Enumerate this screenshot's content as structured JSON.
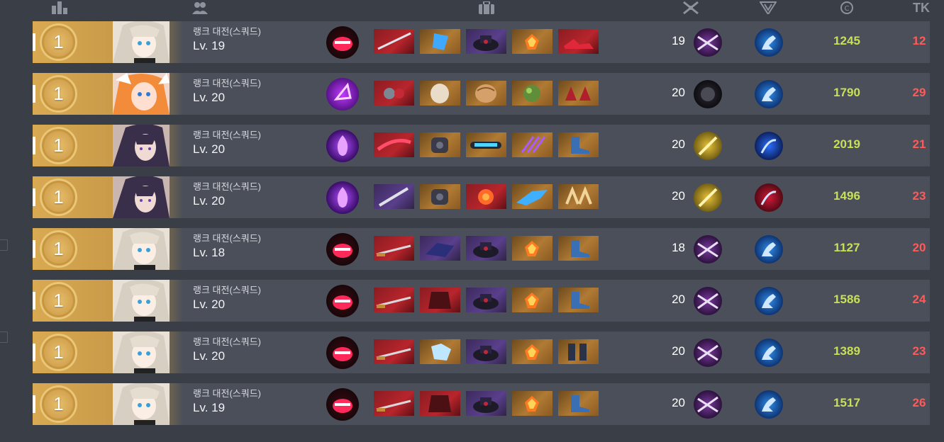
{
  "header": {
    "kills_label": "TK",
    "icons": [
      "rank-bar-icon",
      "party-icon",
      "equipment-bag-icon",
      "weapon-crossed-icon",
      "emblem-icon",
      "credit-icon"
    ]
  },
  "colors": {
    "score": "#c8e058",
    "kills": "#ff5a5a",
    "rank_gold": "#d9aa52",
    "row_bg": "#4a4f59",
    "page_bg": "#3a3e47"
  },
  "rows": [
    {
      "rank": "1",
      "mode": "랭크 대전(스쿼드)",
      "level": "Lv. 19",
      "char": "white",
      "skill": "red-mouth",
      "items": [
        "red-gray",
        "blue",
        "purple-hat",
        "orange-gem",
        "red-shoe"
      ],
      "weapon_level": "19",
      "b1": "purple-blades",
      "b2": "blue-kick",
      "score": "1245",
      "kills": "12"
    },
    {
      "rank": "1",
      "mode": "랭크 대전(스쿼드)",
      "level": "Lv. 20",
      "char": "orange",
      "skill": "purple-spiral",
      "items": [
        "red-chain",
        "orange-hood",
        "orange-hair",
        "orange-green",
        "orange-shoe"
      ],
      "weapon_level": "20",
      "b1": "dark-orb",
      "b2": "blue-kick",
      "score": "1790",
      "kills": "29"
    },
    {
      "rank": "1",
      "mode": "랭크 대전(스쿼드)",
      "level": "Lv. 20",
      "char": "dark",
      "skill": "purple-flame",
      "items": [
        "red-blade",
        "orange-armor",
        "orange-visor",
        "orange-claw",
        "orange-boot"
      ],
      "weapon_level": "20",
      "b1": "gold-dagger",
      "b2": "blue-burst",
      "score": "2019",
      "kills": "21"
    },
    {
      "rank": "1",
      "mode": "랭크 대전(스쿼드)",
      "level": "Lv. 20",
      "char": "dark",
      "skill": "purple-flame",
      "items": [
        "purple-knife",
        "orange-armor",
        "red-flower",
        "orange-wing",
        "orange-gold"
      ],
      "weapon_level": "20",
      "b1": "gold-dagger",
      "b2": "red-burst",
      "score": "1496",
      "kills": "23"
    },
    {
      "rank": "1",
      "mode": "랭크 대전(스쿼드)",
      "level": "Lv. 18",
      "char": "white",
      "skill": "red-mouth",
      "items": [
        "red-katana",
        "purple-base",
        "purple-hat",
        "orange-gem",
        "orange-boot"
      ],
      "weapon_level": "18",
      "b1": "purple-blades",
      "b2": "blue-kick",
      "score": "1127",
      "kills": "20"
    },
    {
      "rank": "1",
      "mode": "랭크 대전(스쿼드)",
      "level": "Lv. 20",
      "char": "white",
      "skill": "red-mouth",
      "items": [
        "red-katana",
        "red-vest",
        "purple-hat",
        "orange-gem",
        "orange-boot"
      ],
      "weapon_level": "20",
      "b1": "purple-blades",
      "b2": "blue-kick",
      "score": "1586",
      "kills": "24"
    },
    {
      "rank": "1",
      "mode": "랭크 대전(스쿼드)",
      "level": "Lv. 20",
      "char": "white",
      "skill": "red-mouth",
      "items": [
        "red-katana",
        "orange-crystal",
        "purple-hat",
        "orange-gem",
        "orange-boot2"
      ],
      "weapon_level": "20",
      "b1": "purple-blades",
      "b2": "blue-kick",
      "score": "1389",
      "kills": "23"
    },
    {
      "rank": "1",
      "mode": "랭크 대전(스쿼드)",
      "level": "Lv. 19",
      "char": "white",
      "skill": "red-mouth",
      "items": [
        "red-katana",
        "red-vest",
        "purple-hat",
        "orange-gem",
        "orange-boot"
      ],
      "weapon_level": "20",
      "b1": "purple-blades",
      "b2": "blue-kick",
      "score": "1517",
      "kills": "26"
    }
  ]
}
